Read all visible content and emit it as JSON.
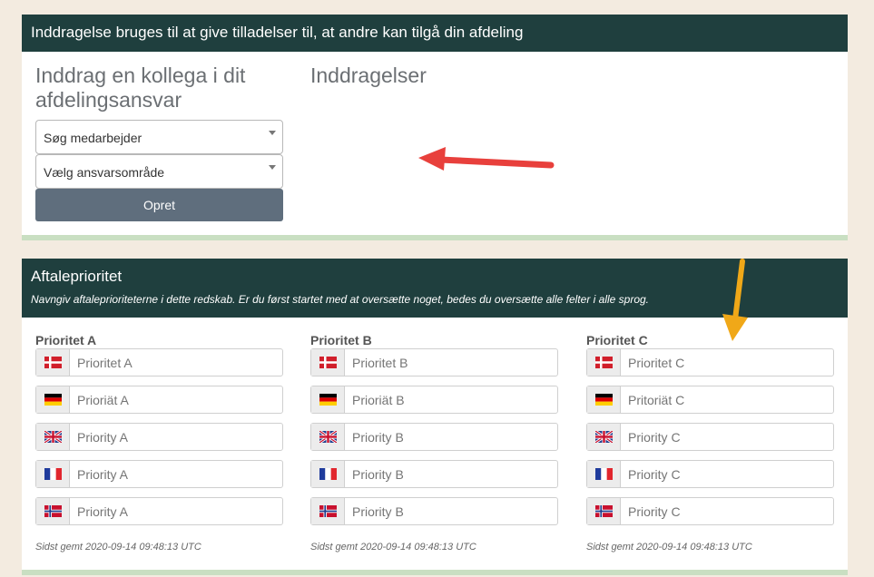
{
  "card1": {
    "header": "Inddragelse bruges til at give tilladelser til, at andre kan tilgå din afdeling",
    "left_title": "Inddrag en kollega i dit afdelingsansvar",
    "right_title": "Inddragelser",
    "select_employee": "Søg medarbejder",
    "select_area": "Vælg ansvarsområde",
    "create_button": "Opret"
  },
  "card2": {
    "header": "Aftaleprioritet",
    "subheader": "Navngiv aftaleprioriteterne i dette redskab. Er du først startet med at oversætte noget, bedes du oversætte alle felter i alle sprog.",
    "columns": [
      {
        "title": "Prioritet A",
        "placeholders": [
          "Prioritet A",
          "Prioriät A",
          "Priority A",
          "Priority A",
          "Priority A"
        ],
        "saved": "Sidst gemt 2020-09-14 09:48:13 UTC"
      },
      {
        "title": "Prioritet B",
        "placeholders": [
          "Prioritet B",
          "Prioriät B",
          "Priority B",
          "Priority B",
          "Priority B"
        ],
        "saved": "Sidst gemt 2020-09-14 09:48:13 UTC"
      },
      {
        "title": "Prioritet C",
        "placeholders": [
          "Prioritet C",
          "Pritoriät C",
          "Priority C",
          "Priority C",
          "Priority C"
        ],
        "saved": "Sidst gemt 2020-09-14 09:48:13 UTC"
      }
    ],
    "flags": [
      "danish-flag-icon",
      "german-flag-icon",
      "uk-flag-icon",
      "french-flag-icon",
      "norwegian-flag-icon"
    ]
  },
  "colors": {
    "header_bg": "#1f3f3e",
    "button_bg": "#5f6e7d",
    "card_border": "#c9dfc2",
    "page_bg": "#f3ebe0",
    "red_arrow": "#e8403c",
    "orange_arrow": "#f0a818"
  }
}
